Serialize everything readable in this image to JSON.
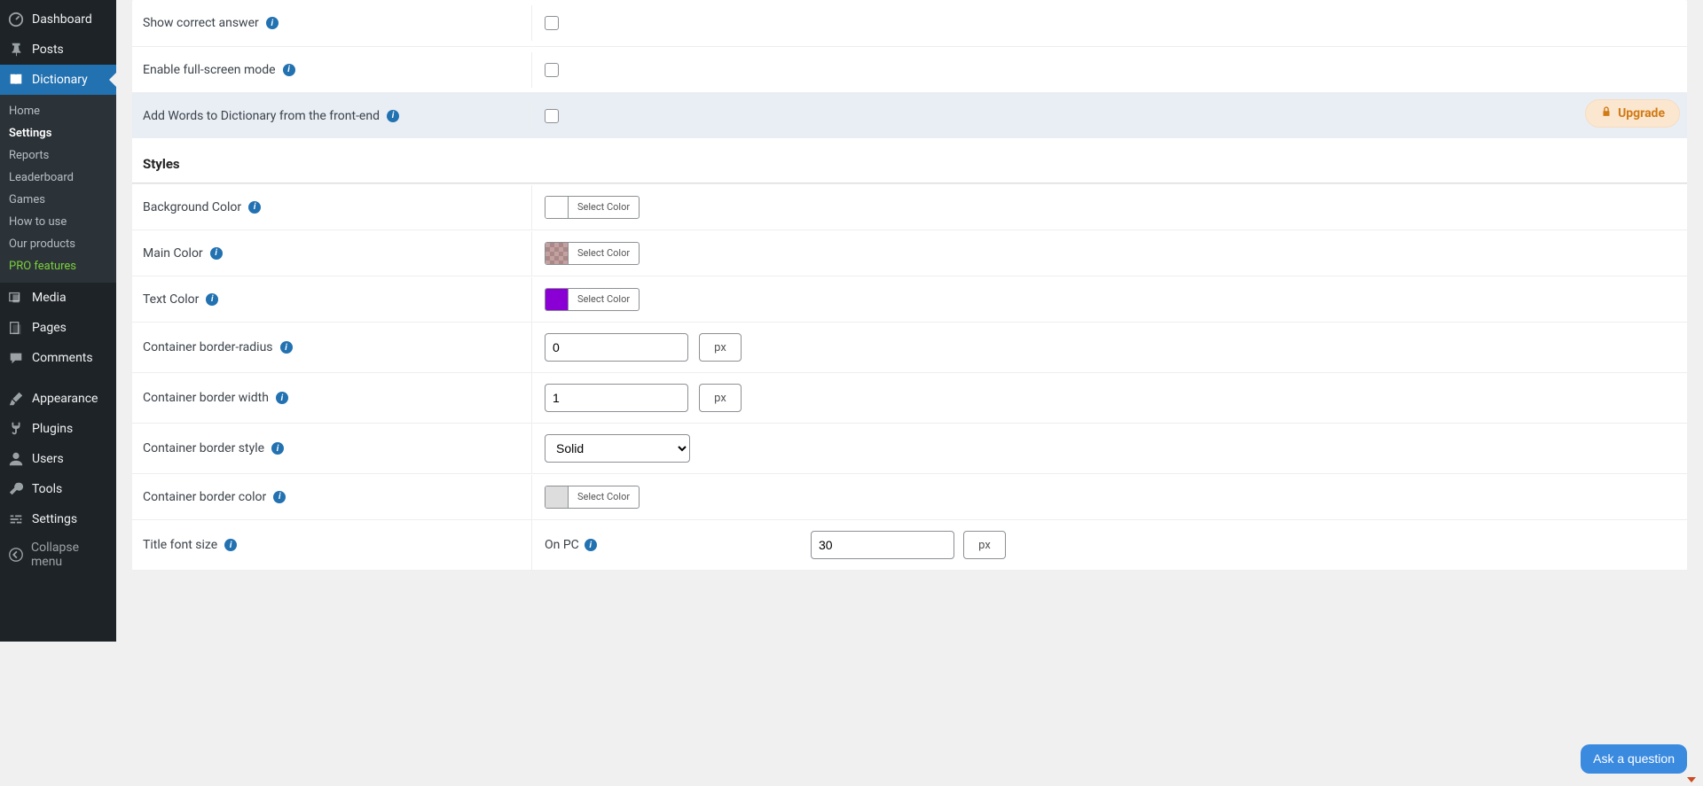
{
  "sidebar": {
    "dashboard": "Dashboard",
    "posts": "Posts",
    "dictionary": "Dictionary",
    "sub": {
      "home": "Home",
      "settings": "Settings",
      "reports": "Reports",
      "leaderboard": "Leaderboard",
      "games": "Games",
      "howtouse": "How to use",
      "ourproducts": "Our products",
      "profeatures": "PRO features"
    },
    "media": "Media",
    "pages": "Pages",
    "comments": "Comments",
    "appearance": "Appearance",
    "plugins": "Plugins",
    "users": "Users",
    "tools": "Tools",
    "settings_main": "Settings",
    "collapse": "Collapse menu"
  },
  "settings": {
    "show_correct_answer": "Show correct answer",
    "enable_fullscreen": "Enable full-screen mode",
    "add_words_front": "Add Words to Dictionary from the front-end",
    "upgrade": "Upgrade",
    "styles_heading": "Styles",
    "background_color": "Background Color",
    "main_color": "Main Color",
    "text_color": "Text Color",
    "container_border_radius": "Container border-radius",
    "container_border_width": "Container border width",
    "container_border_style": "Container border style",
    "container_border_color": "Container border color",
    "title_font_size": "Title font size",
    "on_pc": "On PC",
    "select_color": "Select Color",
    "border_radius_value": "0",
    "border_width_value": "1",
    "border_style_value": "Solid",
    "title_font_size_value": "30",
    "px": "px",
    "colors": {
      "bg": "#ffffff",
      "main_checker": true,
      "text": "#8a00d4",
      "border": "#dddddd"
    }
  },
  "ask_bubble": "Ask a question"
}
